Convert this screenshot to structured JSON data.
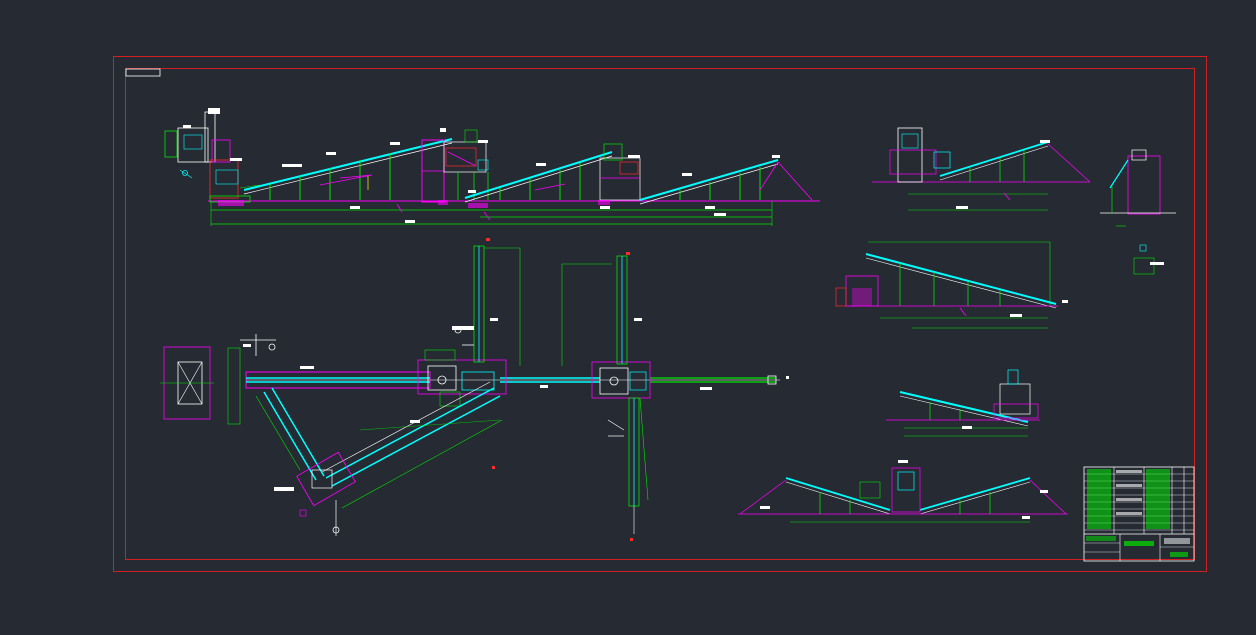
{
  "app": {
    "background": "#252a33"
  },
  "colors": {
    "frame": "#d21f1f",
    "green": "#00e600",
    "magenta": "#ff00ff",
    "cyan": "#00ffff",
    "white": "#ffffff",
    "yellow": "#ffff00",
    "red": "#ff2a2a"
  },
  "drawing": {
    "title_block_label": "",
    "views": [
      "elevation-main-line",
      "plan-view",
      "detail-top-right",
      "detail-side-right",
      "detail-mid-conveyor",
      "detail-small-conveyor",
      "detail-bottom-v-conveyor"
    ]
  }
}
